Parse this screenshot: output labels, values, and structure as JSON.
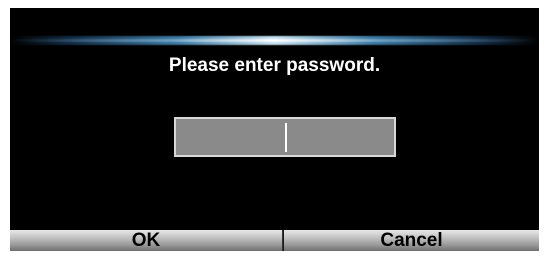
{
  "dialog": {
    "title": "Please enter password.",
    "password": {
      "value": "",
      "placeholder": ""
    },
    "buttons": {
      "ok_label": "OK",
      "cancel_label": "Cancel"
    }
  },
  "colors": {
    "background": "#000000",
    "field_fill": "#8a8a8a",
    "field_border": "#d8d8d8",
    "text": "#ffffff",
    "button_text": "#000000"
  }
}
